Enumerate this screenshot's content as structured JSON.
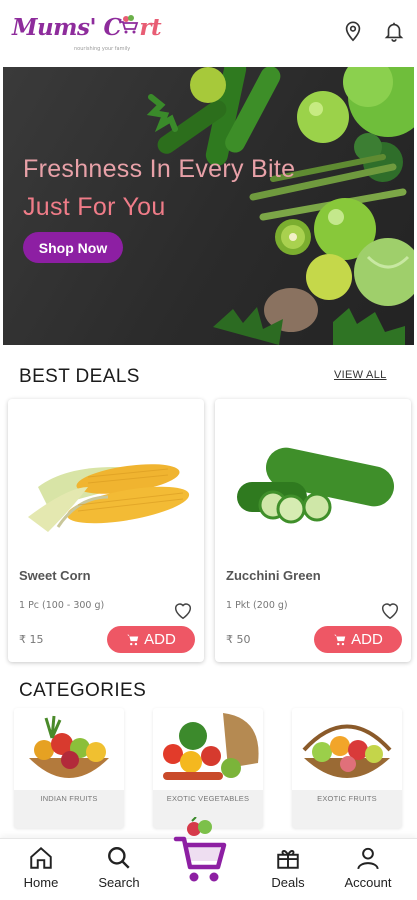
{
  "brand": {
    "logo_text_main": "Mums' C",
    "logo_text_end": "rt",
    "logo_tagline": "nourishing your family"
  },
  "header": {
    "icons": [
      "location-pin-icon",
      "bell-icon"
    ]
  },
  "hero": {
    "line1": "Freshness In Every Bite",
    "line2": "Just For You",
    "cta": "Shop Now"
  },
  "best_deals": {
    "title": "BEST DEALS",
    "view_all": "VIEW ALL",
    "products": [
      {
        "name": "Sweet Corn",
        "qty": "1 Pc (100 - 300 g)",
        "price": "₹ 15",
        "add": "ADD"
      },
      {
        "name": "Zucchini Green",
        "qty": "1 Pkt (200 g)",
        "price": "₹ 50",
        "add": "ADD"
      }
    ]
  },
  "categories": {
    "title": "CATEGORIES",
    "items": [
      {
        "label": "INDIAN FRUITS"
      },
      {
        "label": "EXOTIC VEGETABLES"
      },
      {
        "label": "EXOTIC FRUITS"
      }
    ]
  },
  "nav": {
    "home": "Home",
    "search": "Search",
    "deals": "Deals",
    "account": "Account"
  },
  "colors": {
    "brand_purple": "#8d1fa3",
    "accent_red": "#ee5765",
    "hero_text": "#ef7c88"
  }
}
